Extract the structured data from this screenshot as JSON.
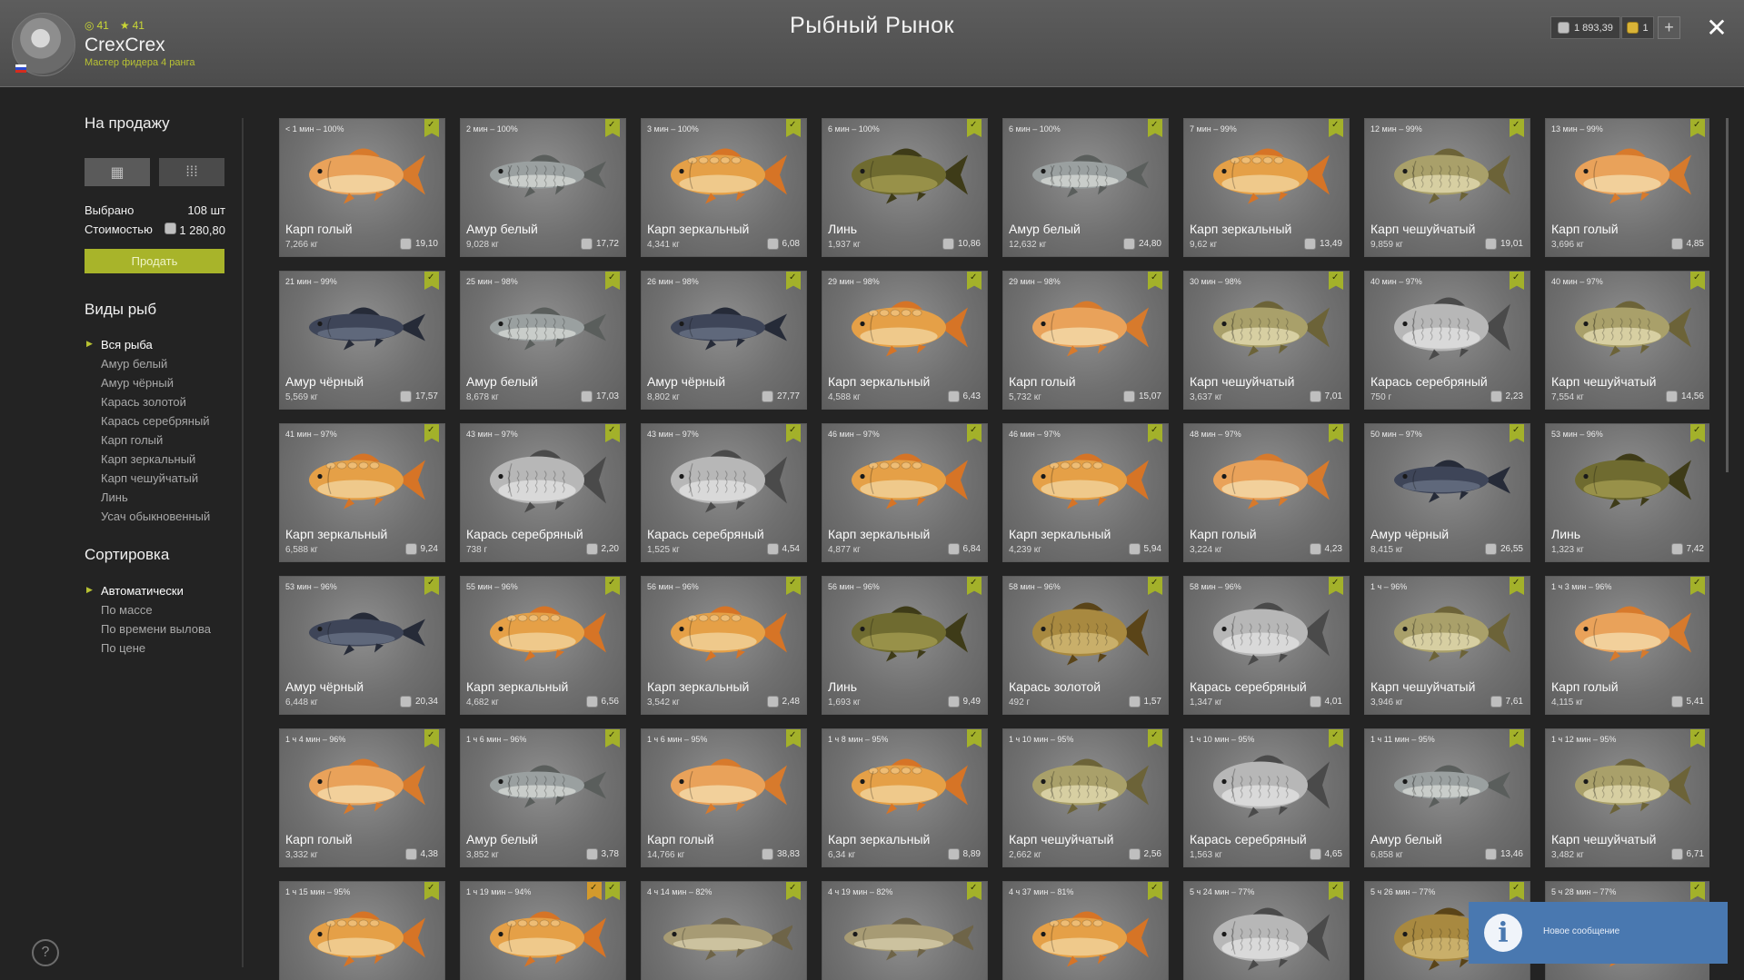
{
  "header": {
    "title": "Рыбный Рынок",
    "username": "CrexCrex",
    "rank": "Мастер фидера 4 ранга",
    "stat_a": "41",
    "stat_b": "41",
    "silver": "1 893,39",
    "gold": "1",
    "plus": "+",
    "close": "✕"
  },
  "sidebar": {
    "for_sale_title": "На продажу",
    "selected_label": "Выбрано",
    "selected_value": "108 шт",
    "cost_label": "Стоимостью",
    "cost_value": "1 280,80",
    "sell_button": "Продать",
    "species_title": "Виды рыб",
    "species": [
      "Вся рыба",
      "Амур белый",
      "Амур чёрный",
      "Карась золотой",
      "Карась серебряный",
      "Карп голый",
      "Карп зеркальный",
      "Карп чешуйчатый",
      "Линь",
      "Усач обыкновенный"
    ],
    "sort_title": "Сортировка",
    "sort_options": [
      "Автоматически",
      "По массе",
      "По времени вылова",
      "По цене"
    ],
    "help": "?"
  },
  "colors": {
    "accent": "#a8b42a",
    "notification": "#4978b0"
  },
  "fish_cards": [
    {
      "time": "< 1 мин – 100%",
      "name": "Карп голый",
      "weight": "7,266 кг",
      "price": "19,10",
      "fish": "naked"
    },
    {
      "time": "2 мин – 100%",
      "name": "Амур белый",
      "weight": "9,028 кг",
      "price": "17,72",
      "fish": "white_amur"
    },
    {
      "time": "3 мин – 100%",
      "name": "Карп зеркальный",
      "weight": "4,341 кг",
      "price": "6,08",
      "fish": "mirror"
    },
    {
      "time": "6 мин – 100%",
      "name": "Линь",
      "weight": "1,937 кг",
      "price": "10,86",
      "fish": "tench"
    },
    {
      "time": "6 мин – 100%",
      "name": "Амур белый",
      "weight": "12,632 кг",
      "price": "24,80",
      "fish": "white_amur"
    },
    {
      "time": "7 мин – 99%",
      "name": "Карп зеркальный",
      "weight": "9,62 кг",
      "price": "13,49",
      "fish": "mirror"
    },
    {
      "time": "12 мин – 99%",
      "name": "Карп чешуйчатый",
      "weight": "9,859 кг",
      "price": "19,01",
      "fish": "scaly"
    },
    {
      "time": "13 мин – 99%",
      "name": "Карп голый",
      "weight": "3,696 кг",
      "price": "4,85",
      "fish": "naked"
    },
    {
      "time": "21 мин – 99%",
      "name": "Амур чёрный",
      "weight": "5,569 кг",
      "price": "17,57",
      "fish": "black_amur"
    },
    {
      "time": "25 мин – 98%",
      "name": "Амур белый",
      "weight": "8,678 кг",
      "price": "17,03",
      "fish": "white_amur"
    },
    {
      "time": "26 мин – 98%",
      "name": "Амур чёрный",
      "weight": "8,802 кг",
      "price": "27,77",
      "fish": "black_amur"
    },
    {
      "time": "29 мин – 98%",
      "name": "Карп зеркальный",
      "weight": "4,588 кг",
      "price": "6,43",
      "fish": "mirror"
    },
    {
      "time": "29 мин – 98%",
      "name": "Карп голый",
      "weight": "5,732 кг",
      "price": "15,07",
      "fish": "naked"
    },
    {
      "time": "30 мин – 98%",
      "name": "Карп чешуйчатый",
      "weight": "3,637 кг",
      "price": "7,01",
      "fish": "scaly"
    },
    {
      "time": "40 мин – 97%",
      "name": "Карась серебряный",
      "weight": "750 г",
      "price": "2,23",
      "fish": "silver"
    },
    {
      "time": "40 мин – 97%",
      "name": "Карп чешуйчатый",
      "weight": "7,554 кг",
      "price": "14,56",
      "fish": "scaly"
    },
    {
      "time": "41 мин – 97%",
      "name": "Карп зеркальный",
      "weight": "6,588 кг",
      "price": "9,24",
      "fish": "mirror"
    },
    {
      "time": "43 мин – 97%",
      "name": "Карась серебряный",
      "weight": "738 г",
      "price": "2,20",
      "fish": "silver"
    },
    {
      "time": "43 мин – 97%",
      "name": "Карась серебряный",
      "weight": "1,525 кг",
      "price": "4,54",
      "fish": "silver"
    },
    {
      "time": "46 мин – 97%",
      "name": "Карп зеркальный",
      "weight": "4,877 кг",
      "price": "6,84",
      "fish": "mirror"
    },
    {
      "time": "46 мин – 97%",
      "name": "Карп зеркальный",
      "weight": "4,239 кг",
      "price": "5,94",
      "fish": "mirror"
    },
    {
      "time": "48 мин – 97%",
      "name": "Карп голый",
      "weight": "3,224 кг",
      "price": "4,23",
      "fish": "naked"
    },
    {
      "time": "50 мин – 97%",
      "name": "Амур чёрный",
      "weight": "8,415 кг",
      "price": "26,55",
      "fish": "black_amur"
    },
    {
      "time": "53 мин – 96%",
      "name": "Линь",
      "weight": "1,323 кг",
      "price": "7,42",
      "fish": "tench"
    },
    {
      "time": "53 мин – 96%",
      "name": "Амур чёрный",
      "weight": "6,448 кг",
      "price": "20,34",
      "fish": "black_amur"
    },
    {
      "time": "55 мин – 96%",
      "name": "Карп зеркальный",
      "weight": "4,682 кг",
      "price": "6,56",
      "fish": "mirror"
    },
    {
      "time": "56 мин – 96%",
      "name": "Карп зеркальный",
      "weight": "3,542 кг",
      "price": "2,48",
      "fish": "mirror"
    },
    {
      "time": "56 мин – 96%",
      "name": "Линь",
      "weight": "1,693 кг",
      "price": "9,49",
      "fish": "tench"
    },
    {
      "time": "58 мин – 96%",
      "name": "Карась золотой",
      "weight": "492 г",
      "price": "1,57",
      "fish": "golden"
    },
    {
      "time": "58 мин – 96%",
      "name": "Карась серебряный",
      "weight": "1,347 кг",
      "price": "4,01",
      "fish": "silver"
    },
    {
      "time": "1 ч – 96%",
      "name": "Карп чешуйчатый",
      "weight": "3,946 кг",
      "price": "7,61",
      "fish": "scaly"
    },
    {
      "time": "1 ч 3 мин – 96%",
      "name": "Карп голый",
      "weight": "4,115 кг",
      "price": "5,41",
      "fish": "naked"
    },
    {
      "time": "1 ч 4 мин – 96%",
      "name": "Карп голый",
      "weight": "3,332 кг",
      "price": "4,38",
      "fish": "naked"
    },
    {
      "time": "1 ч 6 мин – 96%",
      "name": "Амур белый",
      "weight": "3,852 кг",
      "price": "3,78",
      "fish": "white_amur"
    },
    {
      "time": "1 ч 6 мин – 95%",
      "name": "Карп голый",
      "weight": "14,766 кг",
      "price": "38,83",
      "fish": "naked"
    },
    {
      "time": "1 ч 8 мин – 95%",
      "name": "Карп зеркальный",
      "weight": "6,34 кг",
      "price": "8,89",
      "fish": "mirror"
    },
    {
      "time": "1 ч 10 мин – 95%",
      "name": "Карп чешуйчатый",
      "weight": "2,662 кг",
      "price": "2,56",
      "fish": "scaly"
    },
    {
      "time": "1 ч 10 мин – 95%",
      "name": "Карась серебряный",
      "weight": "1,563 кг",
      "price": "4,65",
      "fish": "silver"
    },
    {
      "time": "1 ч 11 мин – 95%",
      "name": "Амур белый",
      "weight": "6,858 кг",
      "price": "13,46",
      "fish": "white_amur"
    },
    {
      "time": "1 ч 12 мин – 95%",
      "name": "Карп чешуйчатый",
      "weight": "3,482 кг",
      "price": "6,71",
      "fish": "scaly"
    },
    {
      "time": "1 ч 15 мин – 95%",
      "name": "",
      "weight": "",
      "price": "",
      "fish": "mirror"
    },
    {
      "time": "1 ч 19 мин – 94%",
      "name": "",
      "weight": "",
      "price": "",
      "fish": "mirror",
      "double": true
    },
    {
      "time": "4 ч 14 мин – 82%",
      "name": "",
      "weight": "",
      "price": "",
      "fish": "barbel"
    },
    {
      "time": "4 ч 19 мин – 82%",
      "name": "",
      "weight": "",
      "price": "",
      "fish": "barbel"
    },
    {
      "time": "4 ч 37 мин – 81%",
      "name": "",
      "weight": "",
      "price": "",
      "fish": "mirror"
    },
    {
      "time": "5 ч 24 мин – 77%",
      "name": "",
      "weight": "",
      "price": "",
      "fish": "silver"
    },
    {
      "time": "5 ч 26 мин – 77%",
      "name": "",
      "weight": "",
      "price": "",
      "fish": "golden"
    },
    {
      "time": "5 ч 28 мин – 77%",
      "name": "",
      "weight": "",
      "price": "",
      "fish": "naked"
    }
  ],
  "notification": {
    "icon": "i",
    "text": "Новое сообщение"
  }
}
